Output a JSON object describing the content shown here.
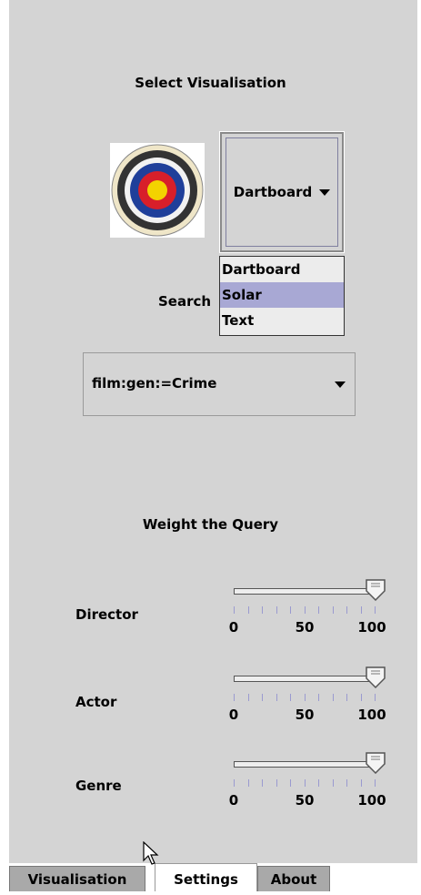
{
  "header": {
    "title": "Select Visualisation"
  },
  "visualisation": {
    "logo": "target-icon",
    "selected": "Dartboard",
    "options": [
      "Dartboard",
      "Solar",
      "Text"
    ],
    "highlighted_option": "Solar"
  },
  "search": {
    "label": "Search",
    "value": "film:gen:=Crime"
  },
  "weights": {
    "title": "Weight the Query",
    "scale": {
      "min": "0",
      "mid": "50",
      "max": "100"
    },
    "items": [
      {
        "label": "Director",
        "value": 100
      },
      {
        "label": "Actor",
        "value": 100
      },
      {
        "label": "Genre",
        "value": 100
      }
    ]
  },
  "tabs": [
    {
      "label": "Visualisation",
      "active": false
    },
    {
      "label": "Settings",
      "active": true
    },
    {
      "label": "About",
      "active": false
    }
  ],
  "colors": {
    "panel": "#d4d4d4",
    "highlight": "#a8a8d4",
    "tick": "#9a9ad0"
  }
}
